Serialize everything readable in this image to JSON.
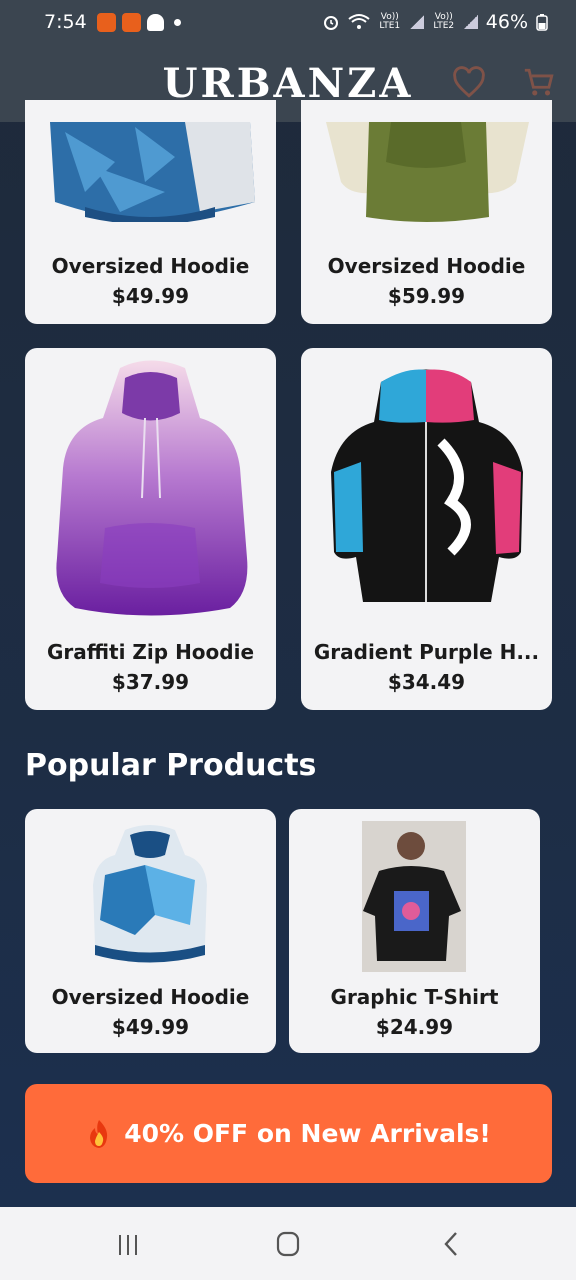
{
  "status_bar": {
    "time": "7:54",
    "battery": "46%",
    "sim1": "Vo)) LTE1",
    "sim2": "Vo)) LTE2"
  },
  "header": {
    "brand": "URBANZA",
    "icons": [
      "heart-icon",
      "cart-icon"
    ]
  },
  "top_products": [
    {
      "name": "Oversized Hoodie",
      "price": "$49.99",
      "image": "blue-geometric-hoodie"
    },
    {
      "name": "Oversized Hoodie",
      "price": "$59.99",
      "image": "green-hoodie"
    }
  ],
  "grid_products": [
    {
      "name": "Graffiti Zip Hoodie",
      "price": "$37.99",
      "image": "purple-gradient-hoodie"
    },
    {
      "name": "Gradient Purple H...",
      "price": "$34.49",
      "image": "graffiti-zip-hoodie"
    }
  ],
  "popular": {
    "title": "Popular Products",
    "items": [
      {
        "name": "Oversized Hoodie",
        "price": "$49.99",
        "image": "blue-splash-hoodie"
      },
      {
        "name": "Graphic T-Shirt",
        "price": "$24.99",
        "image": "graphic-tshirt"
      }
    ]
  },
  "promo": {
    "text": "40% OFF on New Arrivals!",
    "icon": "fire-icon",
    "color": "#ff6b3a"
  },
  "nav": {
    "buttons": [
      "recents-icon",
      "home-icon",
      "back-icon"
    ]
  }
}
